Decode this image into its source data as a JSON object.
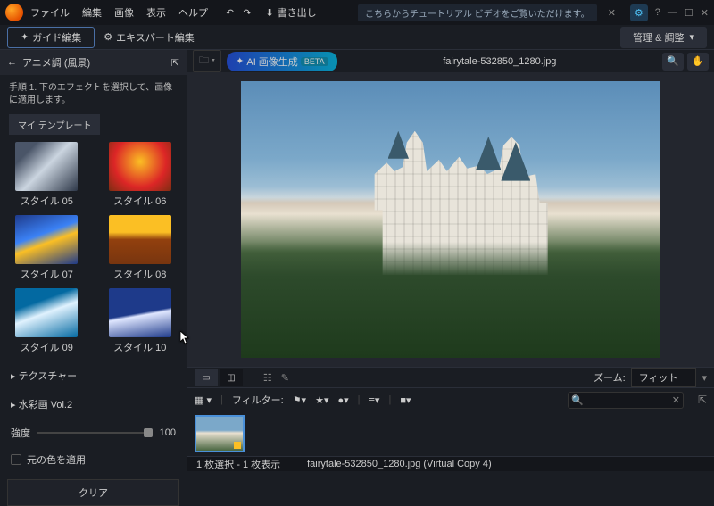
{
  "titlebar": {
    "menu": [
      "ファイル",
      "編集",
      "画像",
      "表示",
      "ヘルプ"
    ],
    "export": "書き出し",
    "tutorial": "こちらからチュートリアル ビデオをご覧いただけます。"
  },
  "toolbar": {
    "guide": "ガイド編集",
    "expert": "エキスパート編集",
    "manage": "管理 & 調整"
  },
  "sidebar": {
    "title": "アニメ調 (風景)",
    "instruction": "手順 1. 下のエフェクトを選択して、画像に適用します。",
    "tab": "マイ テンプレート",
    "styles": [
      {
        "label": "スタイル 05"
      },
      {
        "label": "スタイル 06"
      },
      {
        "label": "スタイル 07"
      },
      {
        "label": "スタイル 08"
      },
      {
        "label": "スタイル 09"
      },
      {
        "label": "スタイル 10"
      }
    ],
    "sections": {
      "texture": "テクスチャー",
      "watercolor": "水彩画 Vol.2"
    },
    "strength_label": "強度",
    "strength_value": "100",
    "original_color": "元の色を適用",
    "clear": "クリア"
  },
  "viewer": {
    "ai_button": "AI 画像生成",
    "beta": "BETA",
    "filename": "fairytale-532850_1280.jpg",
    "zoom_label": "ズーム:",
    "zoom_value": "フィット",
    "filter_label": "フィルター:"
  },
  "status": {
    "selection": "1 枚選択 - 1 枚表示",
    "file": "fairytale-532850_1280.jpg (Virtual Copy 4)"
  }
}
